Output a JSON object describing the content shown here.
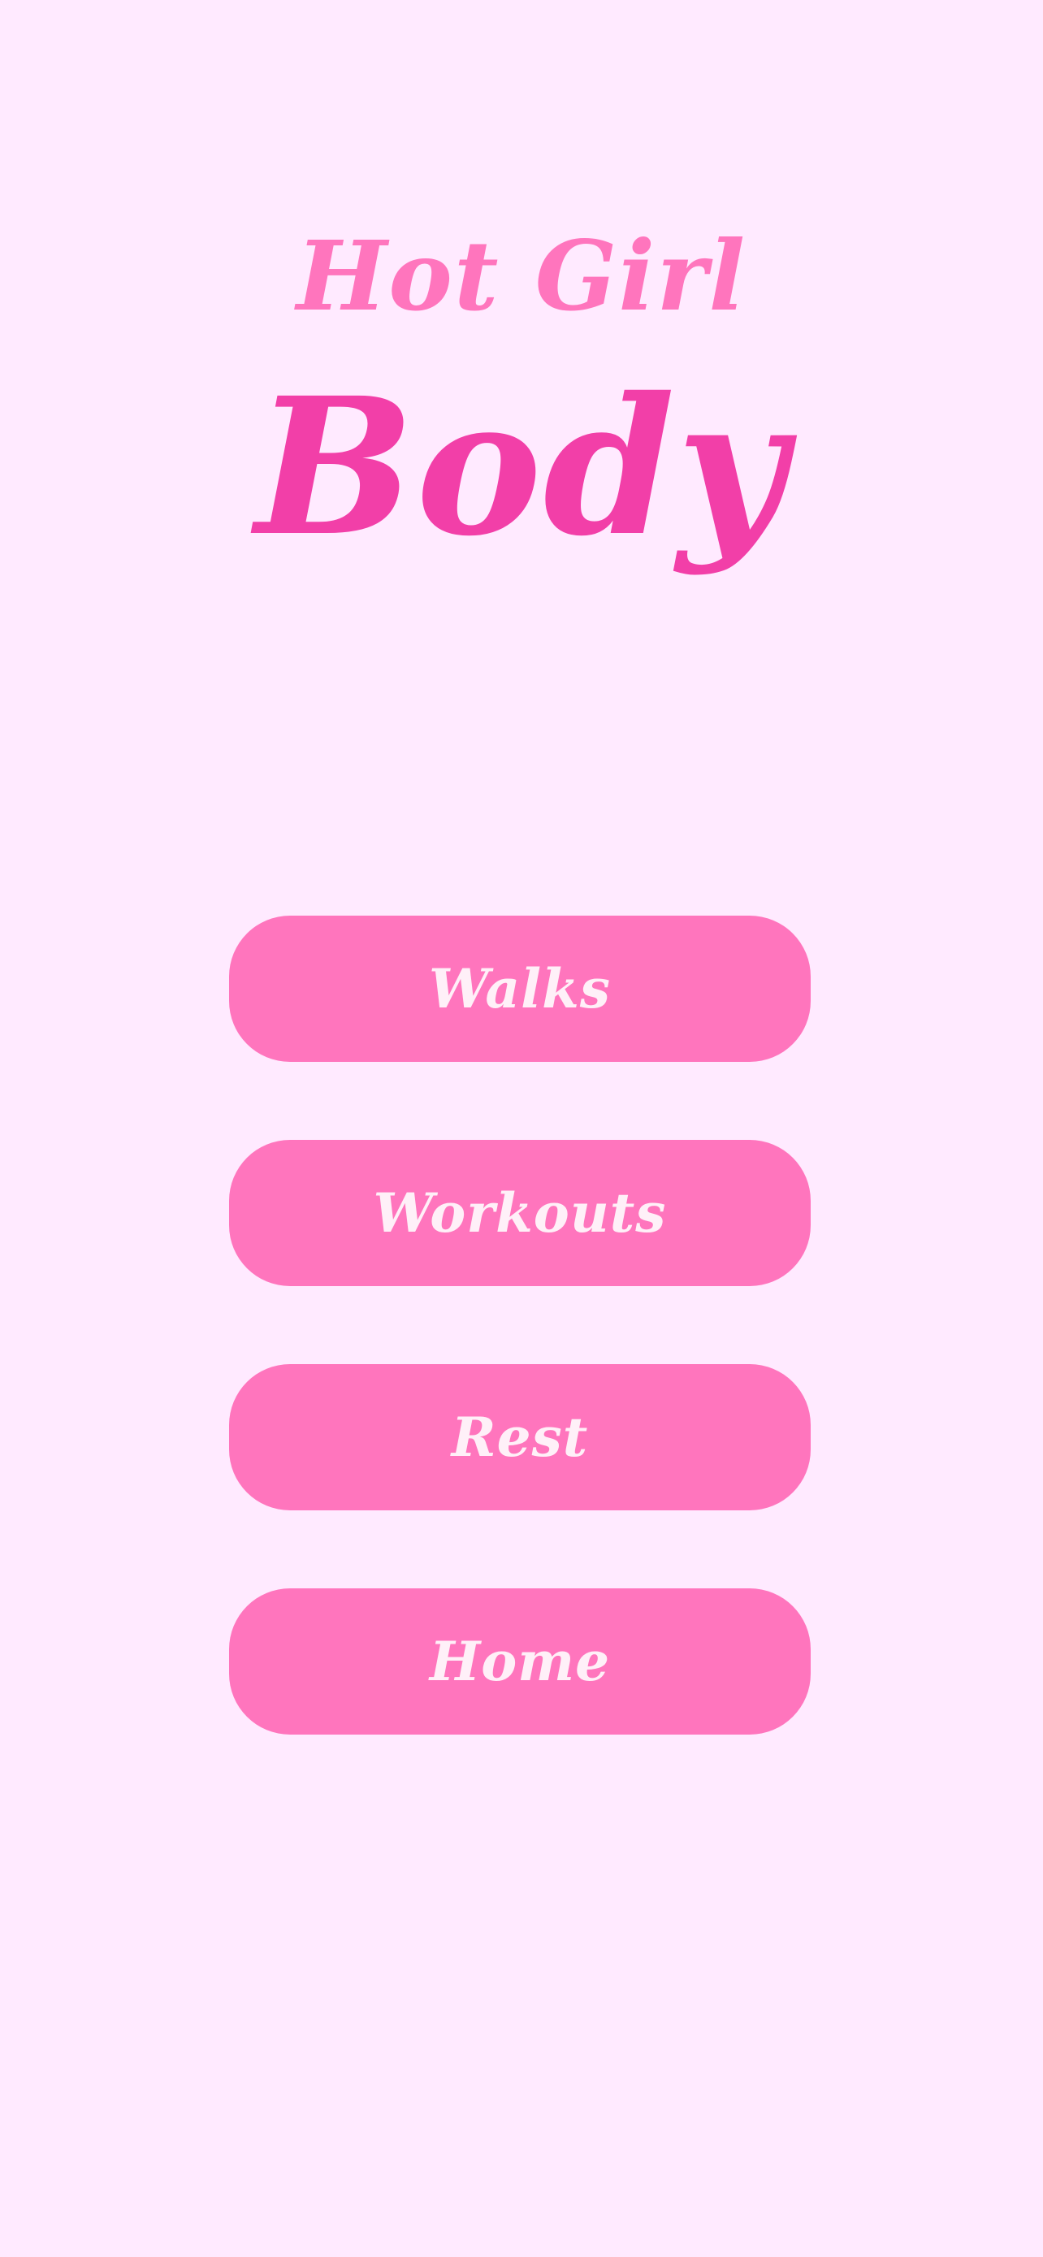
{
  "title": {
    "line1": "Hot Girl",
    "line2": "Body"
  },
  "menu": {
    "items": [
      {
        "label": "Walks"
      },
      {
        "label": "Workouts"
      },
      {
        "label": "Rest"
      },
      {
        "label": "Home"
      }
    ]
  },
  "colors": {
    "background": "#ffeaff",
    "title_small": "#ff75bd",
    "title_big": "#f23fa8",
    "button_fill": "#ff75bd",
    "button_text": "#fff0f8"
  }
}
